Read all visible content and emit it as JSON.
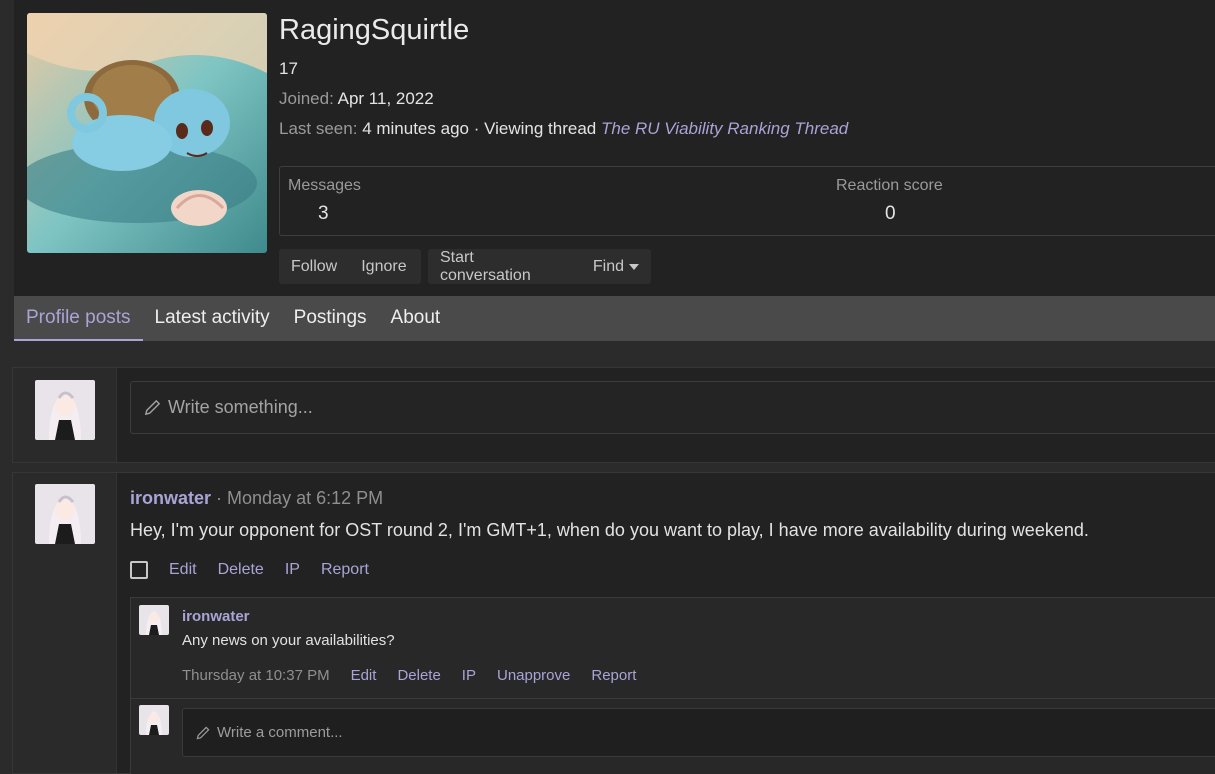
{
  "profile": {
    "username": "RagingSquirtle",
    "user_title": "17",
    "joined_label": "Joined:",
    "joined_value": "Apr 11, 2022",
    "last_seen_label": "Last seen:",
    "last_seen_value": "4 minutes ago · Viewing thread",
    "last_seen_thread": "The RU Viability Ranking Thread",
    "avatar": "squirtle-avatar"
  },
  "stats": {
    "messages_label": "Messages",
    "messages_value": "3",
    "reaction_label": "Reaction score",
    "reaction_value": "0"
  },
  "buttons": {
    "follow": "Follow",
    "ignore": "Ignore",
    "start_conversation": "Start conversation",
    "find": "Find"
  },
  "tabs": [
    "Profile posts",
    "Latest activity",
    "Postings",
    "About"
  ],
  "active_tab": "Profile posts",
  "composer": {
    "placeholder": "Write something..."
  },
  "post": {
    "author": "ironwater",
    "timestamp": "Monday at 6:12 PM",
    "separator": " · ",
    "body": "Hey, I'm your opponent for OST round 2, I'm GMT+1, when do you want to play, I have more availability during weekend.",
    "actions": [
      "Edit",
      "Delete",
      "IP",
      "Report"
    ]
  },
  "comment": {
    "author": "ironwater",
    "body": "Any news on your availabilities?",
    "timestamp": "Thursday at 10:37 PM",
    "actions": [
      "Edit",
      "Delete",
      "IP",
      "Unapprove",
      "Report"
    ],
    "write_placeholder": "Write a comment..."
  },
  "colors": {
    "accent": "#a9a4d6",
    "background": "#2b2b2b",
    "panel": "#222222",
    "tabs_bar": "#4a4a4a"
  }
}
